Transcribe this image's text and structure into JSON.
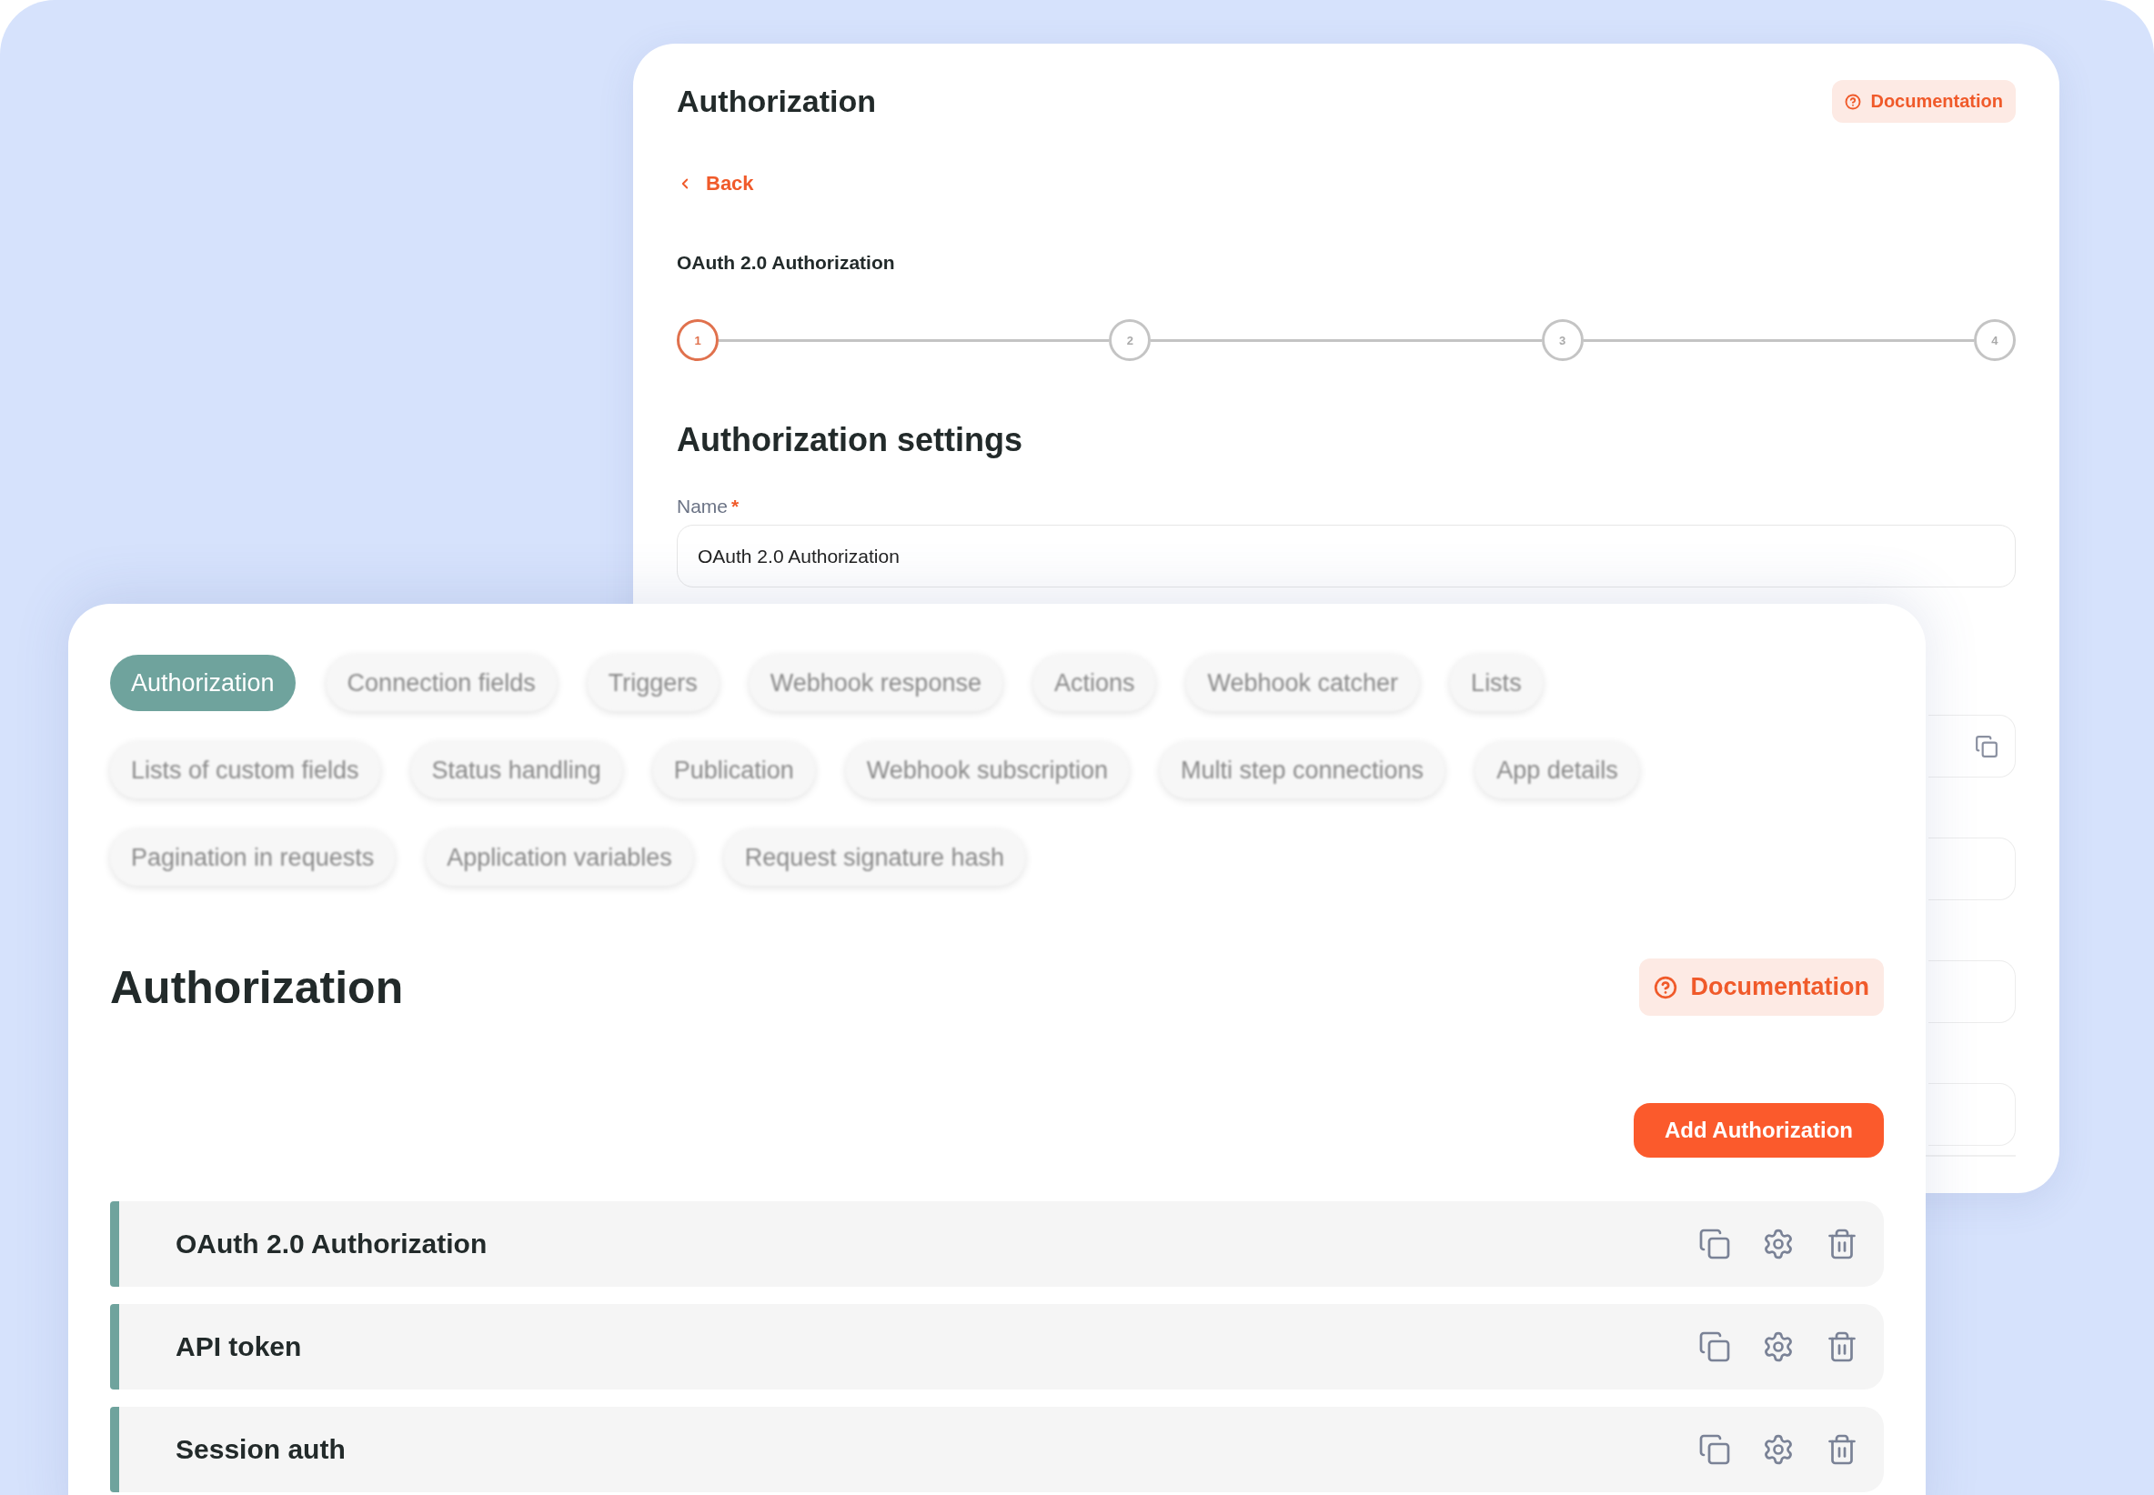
{
  "back_window": {
    "title": "Authorization",
    "documentation_button": "Documentation",
    "back_link": "Back",
    "subtitle": "OAuth 2.0 Authorization",
    "steps": [
      {
        "label": "1",
        "selected": true
      },
      {
        "label": "2",
        "selected": false
      },
      {
        "label": "3",
        "selected": false
      },
      {
        "label": "4",
        "selected": false
      }
    ],
    "section_title": "Authorization settings",
    "name_field": {
      "label": "Name",
      "required_mark": "*",
      "value": "OAuth 2.0 Authorization"
    }
  },
  "front_window": {
    "tabs": [
      {
        "label": "Authorization",
        "selected": true
      },
      {
        "label": "Connection fields",
        "selected": false
      },
      {
        "label": "Triggers",
        "selected": false
      },
      {
        "label": "Webhook response",
        "selected": false
      },
      {
        "label": "Actions",
        "selected": false
      },
      {
        "label": "Webhook catcher",
        "selected": false
      },
      {
        "label": "Lists",
        "selected": false
      },
      {
        "label": "Lists of custom fields",
        "selected": false
      },
      {
        "label": "Status handling",
        "selected": false
      },
      {
        "label": "Publication",
        "selected": false
      },
      {
        "label": "Webhook subscription",
        "selected": false
      },
      {
        "label": "Multi step connections",
        "selected": false
      },
      {
        "label": "App details",
        "selected": false
      },
      {
        "label": "Pagination in requests",
        "selected": false
      },
      {
        "label": "Application variables",
        "selected": false
      },
      {
        "label": "Request signature hash",
        "selected": false
      }
    ],
    "title": "Authorization",
    "documentation_button": "Documentation",
    "add_button": "Add Authorization",
    "authorizations": [
      {
        "name": "OAuth 2.0 Authorization"
      },
      {
        "name": "API token"
      },
      {
        "name": "Session auth"
      }
    ]
  }
}
